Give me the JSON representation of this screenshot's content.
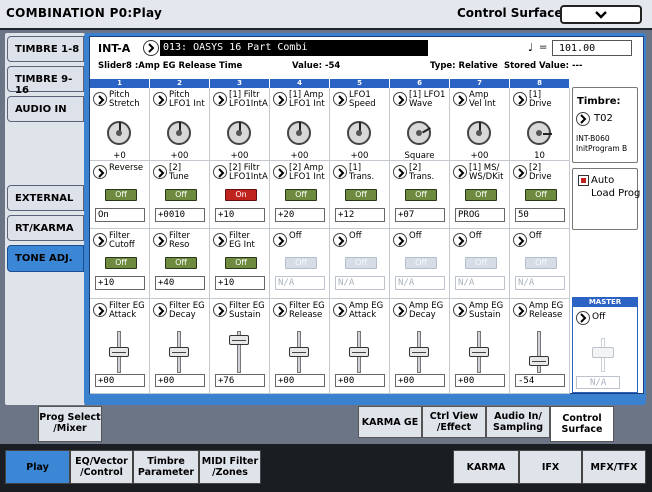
{
  "title": "COMBINATION P0:Play",
  "page_name": "Control Surface",
  "header": {
    "bank": "INT-A",
    "combination": "013: OASYS 16 Part Combi",
    "tempo_eq": "=",
    "tempo": "101.00",
    "slider_info": "Slider8 :Amp EG Release Time",
    "value_info": "Value: -54",
    "type_info": "Type: Relative",
    "stored_info": "Stored Value: ---"
  },
  "side_tabs": [
    "TIMBRE 1-8",
    "TIMBRE 9-16",
    "AUDIO IN",
    "EXTERNAL",
    "RT/KARMA",
    "TONE ADJ."
  ],
  "columns": [
    "1",
    "2",
    "3",
    "4",
    "5",
    "6",
    "7",
    "8"
  ],
  "row1": [
    {
      "label": "Pitch\nStretch",
      "value": "+0"
    },
    {
      "label": "Pitch\nLFO1 Int",
      "value": "+00"
    },
    {
      "label": "[1] Filtr\nLFO1IntA",
      "value": "+00"
    },
    {
      "label": "[1] Amp\nLFO1 Int",
      "value": "+00"
    },
    {
      "label": "LFO1\nSpeed",
      "value": "+00"
    },
    {
      "label": "[1] LFO1\nWave",
      "value": "Square"
    },
    {
      "label": "Amp\nVel Int",
      "value": "+00"
    },
    {
      "label": "[1]\nDrive",
      "value": "10"
    }
  ],
  "row2": [
    {
      "label": "Reverse",
      "toggle": "Off",
      "value": "On"
    },
    {
      "label": "[2]\nTune",
      "toggle": "Off",
      "value": "+0010"
    },
    {
      "label": "[2] Filtr\nLFO1IntA",
      "toggle": "On",
      "value": "+10"
    },
    {
      "label": "[2] Amp\nLFO1 Int",
      "toggle": "Off",
      "value": "+20"
    },
    {
      "label": "[1]\nTrans.",
      "toggle": "Off",
      "value": "+12"
    },
    {
      "label": "[2]\nTrans.",
      "toggle": "Off",
      "value": "+07"
    },
    {
      "label": "[1] MS/\nWS/DKit",
      "toggle": "Off",
      "value": "PROG"
    },
    {
      "label": "[2]\nDrive",
      "toggle": "Off",
      "value": "50"
    }
  ],
  "row3": [
    {
      "label": "Filter\nCutoff",
      "toggle": "Off",
      "value": "+10"
    },
    {
      "label": "Filter\nReso",
      "toggle": "Off",
      "value": "+40"
    },
    {
      "label": "Filter\nEG Int",
      "toggle": "Off",
      "value": "+10"
    },
    {
      "label": "Off",
      "toggle": "Off",
      "value": "N/A"
    },
    {
      "label": "Off",
      "toggle": "Off",
      "value": "N/A"
    },
    {
      "label": "Off",
      "toggle": "Off",
      "value": "N/A"
    },
    {
      "label": "Off",
      "toggle": "Off",
      "value": "N/A"
    },
    {
      "label": "Off",
      "toggle": "Off",
      "value": "N/A"
    }
  ],
  "row4": [
    {
      "label": "Filter EG\nAttack",
      "value": "+00"
    },
    {
      "label": "Filter EG\nDecay",
      "value": "+00"
    },
    {
      "label": "Filter EG\nSustain",
      "value": "+76"
    },
    {
      "label": "Filter EG\nRelease",
      "value": "+00"
    },
    {
      "label": "Amp EG\nAttack",
      "value": "+00"
    },
    {
      "label": "Amp EG\nDecay",
      "value": "+00"
    },
    {
      "label": "Amp EG\nSustain",
      "value": "+00"
    },
    {
      "label": "Amp EG\nRelease",
      "value": "-54"
    }
  ],
  "timbre": {
    "title": "Timbre:",
    "value": "T02",
    "bank": "INT-B060",
    "program": "InitProgram B"
  },
  "autoload": {
    "label": "Auto\nLoad Prog"
  },
  "master": {
    "header": "MASTER",
    "label": "Off",
    "value": "N/A"
  },
  "upper_tabs": [
    "Prog Select\n/Mixer",
    "KARMA GE",
    "Ctrl View\n/Effect",
    "Audio In/\nSampling",
    "Control\nSurface"
  ],
  "bottom_tabs": [
    "Play",
    "EQ/Vector\n/Control",
    "Timbre\nParameter",
    "MIDI Filter\n/Zones",
    "KARMA",
    "IFX",
    "MFX/TFX"
  ]
}
